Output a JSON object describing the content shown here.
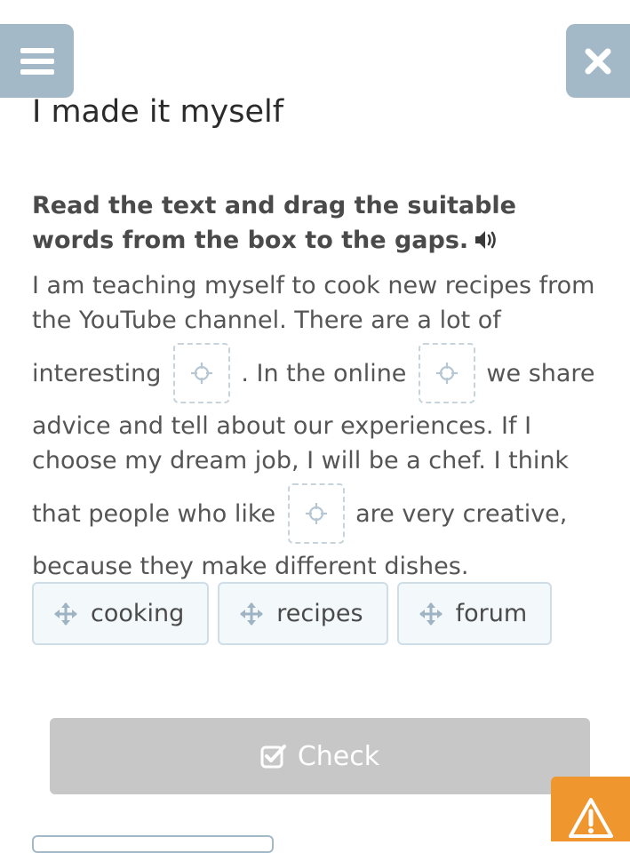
{
  "header": {
    "title": "I made it myself"
  },
  "exercise": {
    "instruction": "Read the text and drag the suitable words from the box to the gaps.",
    "passage": {
      "line1": "I am teaching myself to cook new recipes from",
      "line2": "the YouTube channel. There are a lot of",
      "line3_before": "interesting",
      "line3_middle": ". In the online",
      "line3_after": "we share",
      "line4": "advice and tell about our experiences. If I",
      "line5": "choose my dream job, I will be a chef. I think",
      "line6_before": "that people who like",
      "line6_after": "are very creative,",
      "line7": "because they make different dishes."
    },
    "word_bank": [
      {
        "label": "cooking"
      },
      {
        "label": "recipes"
      },
      {
        "label": "forum"
      }
    ],
    "check_label": "Check"
  },
  "icons": {
    "menu": "menu-icon",
    "close": "close-icon",
    "speaker": "speaker-icon",
    "gap": "crosshair-icon",
    "chip": "move-icon",
    "check": "checkbox-icon",
    "warning": "warning-icon"
  },
  "colors": {
    "nav_button": "#a3b9c8",
    "check_button": "#c7c7c7",
    "warning_button": "#f0962e",
    "chip_background": "#f3f8fb",
    "chip_border": "#cfdde6"
  }
}
